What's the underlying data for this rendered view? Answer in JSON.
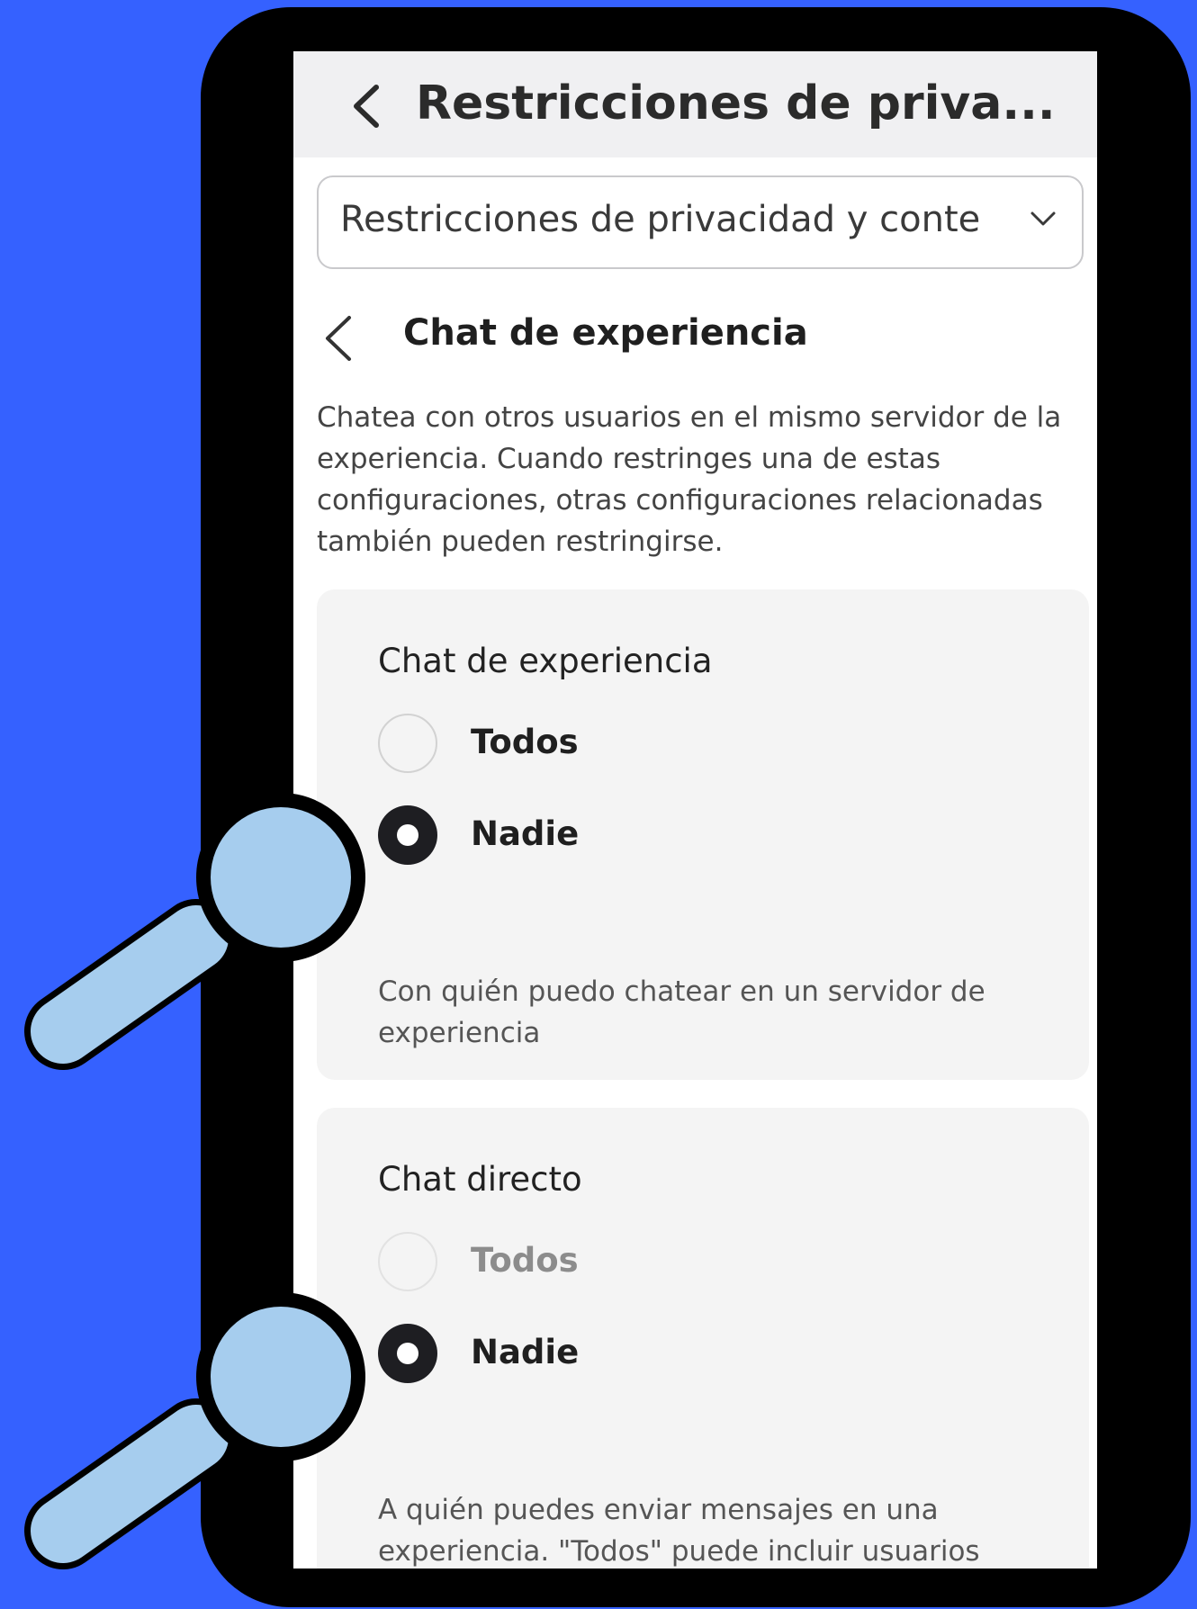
{
  "header": {
    "title": "Restricciones de priva..."
  },
  "dropdown": {
    "value": "Restricciones de privacidad y conte"
  },
  "section": {
    "title": "Chat de experiencia",
    "description": "Chatea con otros usuarios en el mismo servidor de la experiencia. Cuando restringes una de estas configuraciones, otras configuraciones relacionadas también pueden restringirse."
  },
  "experience_chat": {
    "title": "Chat de experiencia",
    "options": [
      {
        "label": "Todos",
        "selected": false
      },
      {
        "label": "Nadie",
        "selected": true
      }
    ],
    "description": "Con quién puedo chatear en un servidor de experiencia"
  },
  "direct_chat": {
    "title": "Chat directo",
    "options": [
      {
        "label": "Todos",
        "selected": false,
        "disabled": true
      },
      {
        "label": "Nadie",
        "selected": true
      }
    ],
    "description": "A quién puedes enviar mensajes en una experiencia. \"Todos\" puede incluir usuarios fuera de tu lista de amigos."
  },
  "colors": {
    "background": "#3561ff",
    "phone_frame": "#000000",
    "magnifier": "#a6cdee",
    "card": "#f4f4f4"
  },
  "icons": {
    "header_back": "chevron-left-icon",
    "dropdown": "chevron-down-icon",
    "section_back": "chevron-left-icon",
    "magnifier": "magnifying-glass-icon"
  }
}
